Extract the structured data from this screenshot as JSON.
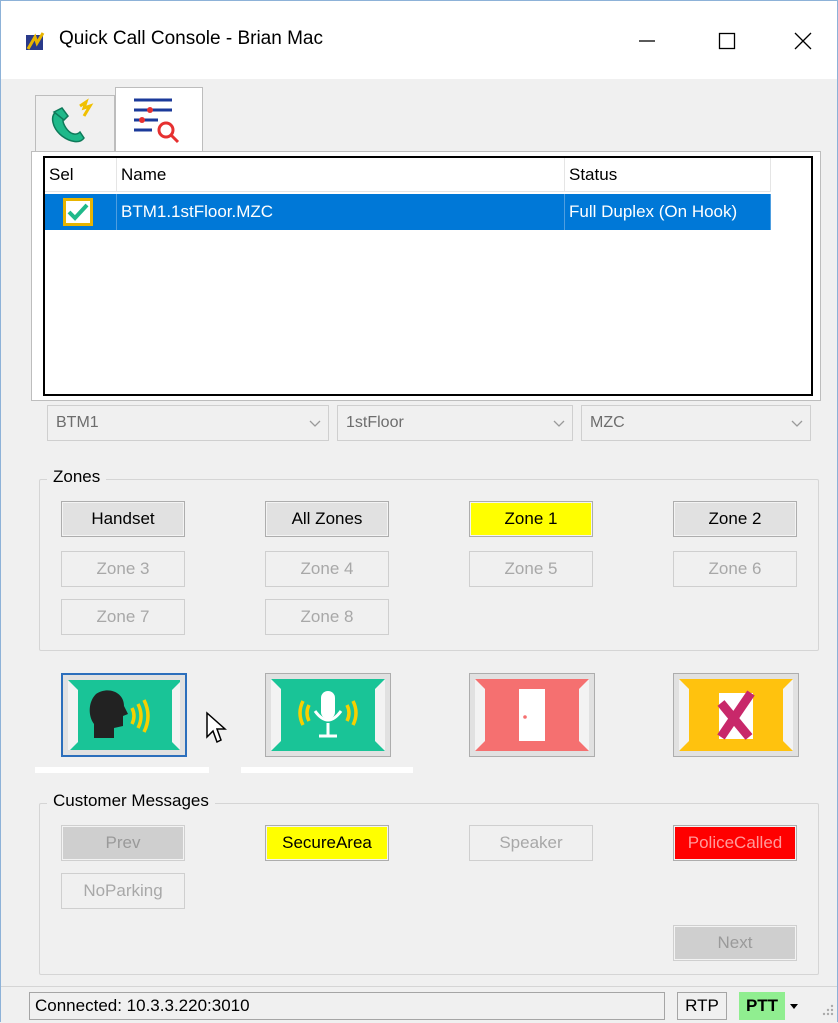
{
  "window": {
    "title": "Quick Call Console - Brian Mac",
    "app_icon": "app-logo-icon",
    "controls": [
      "minimize-icon",
      "maximize-icon",
      "close-icon"
    ]
  },
  "tabs": [
    {
      "name": "call-tab",
      "icon": "phone-handset-icon",
      "active": false
    },
    {
      "name": "list-tab",
      "icon": "list-search-icon",
      "active": true
    }
  ],
  "listview": {
    "columns": [
      "Sel",
      "Name",
      "Status"
    ],
    "rows": [
      {
        "selected": true,
        "name": "BTM1.1stFloor.MZC",
        "status": "Full Duplex (On Hook)"
      }
    ]
  },
  "filters": {
    "building": "BTM1",
    "floor": "1stFloor",
    "device": "MZC"
  },
  "zones": {
    "label": "Zones",
    "buttons": [
      {
        "label": "Handset",
        "state": "enabled"
      },
      {
        "label": "All Zones",
        "state": "enabled"
      },
      {
        "label": "Zone 1",
        "state": "active"
      },
      {
        "label": "Zone 2",
        "state": "enabled"
      },
      {
        "label": "Zone 3",
        "state": "disabled"
      },
      {
        "label": "Zone 4",
        "state": "disabled"
      },
      {
        "label": "Zone 5",
        "state": "disabled"
      },
      {
        "label": "Zone 6",
        "state": "disabled"
      },
      {
        "label": "Zone 7",
        "state": "disabled"
      },
      {
        "label": "Zone 8",
        "state": "disabled"
      }
    ]
  },
  "actions": [
    {
      "name": "talk-button",
      "icon": "talking-head-icon",
      "color": "#19c497"
    },
    {
      "name": "microphone-button",
      "icon": "microphone-icon",
      "color": "#19c497"
    },
    {
      "name": "door-button",
      "icon": "door-icon",
      "color": "#f57070"
    },
    {
      "name": "cancel-button",
      "icon": "x-mark-icon",
      "color": "#ffc20e"
    }
  ],
  "messages": {
    "label": "Customer Messages",
    "prev": "Prev",
    "next": "Next",
    "items": [
      {
        "label": "SecureArea",
        "color": "#ffff00"
      },
      {
        "label": "Speaker",
        "color": "#f0f0f0"
      },
      {
        "label": "PoliceCalled",
        "color": "#ff0000"
      },
      {
        "label": "NoParking",
        "color": "#f0f0f0"
      }
    ]
  },
  "status": {
    "connection": "Connected: 10.3.3.220:3010",
    "rtp": "RTP",
    "ptt": "PTT",
    "ptt_color": "#90ee90"
  }
}
